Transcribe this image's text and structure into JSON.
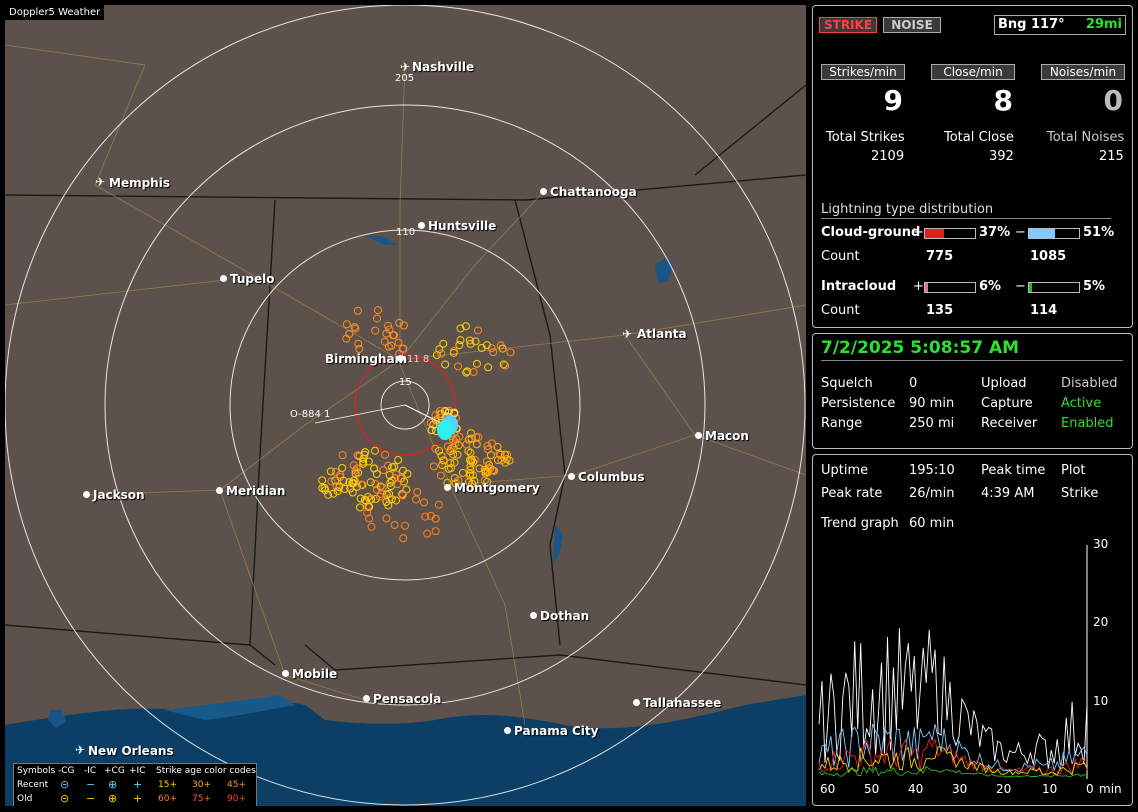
{
  "window_title": "Doppler5 Weather",
  "cities": [
    {
      "name": "Nashville",
      "type": "airport"
    },
    {
      "name": "Memphis",
      "type": "airport"
    },
    {
      "name": "Chattanooga",
      "type": "dot"
    },
    {
      "name": "Huntsville",
      "type": "dot"
    },
    {
      "name": "Tupelo",
      "type": "dot"
    },
    {
      "name": "Atlanta",
      "type": "airport"
    },
    {
      "name": "Birmingham",
      "type": "dot"
    },
    {
      "name": "Macon",
      "type": "dot"
    },
    {
      "name": "Jackson",
      "type": "dot"
    },
    {
      "name": "Meridian",
      "type": "dot"
    },
    {
      "name": "Montgomery",
      "type": "dot"
    },
    {
      "name": "Columbus",
      "type": "dot"
    },
    {
      "name": "Dothan",
      "type": "dot"
    },
    {
      "name": "Mobile",
      "type": "dot"
    },
    {
      "name": "Pensacola",
      "type": "dot"
    },
    {
      "name": "Tallahassee",
      "type": "dot"
    },
    {
      "name": "Panama City",
      "type": "dot"
    },
    {
      "name": "New Orleans",
      "type": "airport"
    }
  ],
  "range_labels": [
    "205",
    "110",
    "15"
  ],
  "map_markers": {
    "strike_label": "11 8",
    "noise_label": "O-884 1"
  },
  "legend": {
    "header": [
      "Symbols",
      "-CG",
      "-IC",
      "+CG",
      "+IC",
      "Strike age color codes"
    ],
    "recent_label": "Recent",
    "old_label": "Old",
    "recent_ages": [
      "15+",
      "30+",
      "45+"
    ],
    "old_ages": [
      "60+",
      "75+",
      "90+"
    ]
  },
  "top_panel": {
    "strike_button": "STRIKE",
    "noise_button": "NOISE",
    "bearing": "Bng 117°",
    "distance": "29mi",
    "rate_headers": [
      "Strikes/min",
      "Close/min",
      "Noises/min"
    ],
    "rates": [
      "9",
      "8",
      "0"
    ],
    "total_labels": [
      "Total Strikes",
      "Total Close",
      "Total Noises"
    ],
    "totals": [
      "2109",
      "392",
      "215"
    ],
    "dist_title": "Lightning type distribution",
    "cg_label": "Cloud-ground",
    "cg_pos_pct": "37%",
    "cg_neg_pct": "51%",
    "cg_pos_fill": 0.37,
    "cg_neg_fill": 0.51,
    "count_label": "Count",
    "cg_pos_count": "775",
    "cg_neg_count": "1085",
    "ic_label": "Intracloud",
    "ic_pos_pct": "6%",
    "ic_neg_pct": "5%",
    "ic_pos_fill": 0.06,
    "ic_neg_fill": 0.05,
    "ic_pos_count": "135",
    "ic_neg_count": "114",
    "plus": "+",
    "minus": "−"
  },
  "status_panel": {
    "datetime": "7/2/2025 5:08:57 AM",
    "rows": [
      {
        "k1": "Squelch",
        "v1": "0",
        "k2": "Upload",
        "v2": "Disabled"
      },
      {
        "k1": "Persistence",
        "v1": "90 min",
        "k2": "Capture",
        "v2": "Active"
      },
      {
        "k1": "Range",
        "v1": "250 mi",
        "k2": "Receiver",
        "v2": "Enabled"
      }
    ]
  },
  "trend_panel": {
    "uptime_label": "Uptime",
    "uptime": "195:10",
    "peak_time_label": "Peak time",
    "plot_label": "Plot",
    "peak_rate_label": "Peak rate",
    "peak_rate": "26/min",
    "peak_time": "4:39 AM",
    "plot_value": "Strike",
    "trend_label": "Trend graph",
    "trend_value": "60 min",
    "x_ticks": [
      "60",
      "50",
      "40",
      "30",
      "20",
      "10",
      "0"
    ],
    "x_unit": "min",
    "y_ticks": [
      "30",
      "20",
      "10"
    ]
  },
  "colors": {
    "recent_cg": "#5ad0ff",
    "old": "#ffd000",
    "strike_red": "#e02020",
    "ic_pos": "#e070a0",
    "ic_neg": "#20c020",
    "cg_neg": "#80c8ff"
  }
}
